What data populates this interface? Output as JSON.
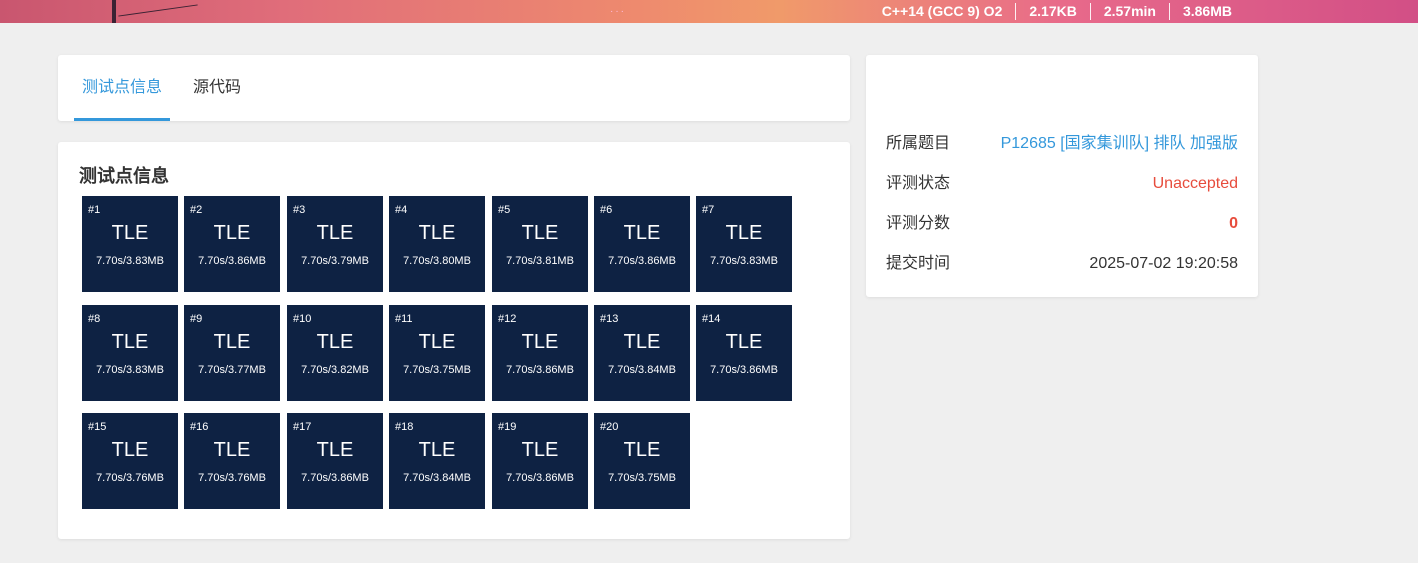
{
  "banner": {
    "stats": [
      "C++14 (GCC 9) O2",
      "2.17KB",
      "2.57min",
      "3.86MB"
    ]
  },
  "tabs": [
    {
      "label": "测试点信息",
      "active": true
    },
    {
      "label": "源代码",
      "active": false
    }
  ],
  "cases": {
    "title": "测试点信息",
    "items": [
      {
        "id": "#1",
        "status": "TLE",
        "info": "7.70s/3.83MB"
      },
      {
        "id": "#2",
        "status": "TLE",
        "info": "7.70s/3.86MB"
      },
      {
        "id": "#3",
        "status": "TLE",
        "info": "7.70s/3.79MB"
      },
      {
        "id": "#4",
        "status": "TLE",
        "info": "7.70s/3.80MB"
      },
      {
        "id": "#5",
        "status": "TLE",
        "info": "7.70s/3.81MB"
      },
      {
        "id": "#6",
        "status": "TLE",
        "info": "7.70s/3.86MB"
      },
      {
        "id": "#7",
        "status": "TLE",
        "info": "7.70s/3.83MB"
      },
      {
        "id": "#8",
        "status": "TLE",
        "info": "7.70s/3.83MB"
      },
      {
        "id": "#9",
        "status": "TLE",
        "info": "7.70s/3.77MB"
      },
      {
        "id": "#10",
        "status": "TLE",
        "info": "7.70s/3.82MB"
      },
      {
        "id": "#11",
        "status": "TLE",
        "info": "7.70s/3.75MB"
      },
      {
        "id": "#12",
        "status": "TLE",
        "info": "7.70s/3.86MB"
      },
      {
        "id": "#13",
        "status": "TLE",
        "info": "7.70s/3.84MB"
      },
      {
        "id": "#14",
        "status": "TLE",
        "info": "7.70s/3.86MB"
      },
      {
        "id": "#15",
        "status": "TLE",
        "info": "7.70s/3.76MB"
      },
      {
        "id": "#16",
        "status": "TLE",
        "info": "7.70s/3.76MB"
      },
      {
        "id": "#17",
        "status": "TLE",
        "info": "7.70s/3.86MB"
      },
      {
        "id": "#18",
        "status": "TLE",
        "info": "7.70s/3.84MB"
      },
      {
        "id": "#19",
        "status": "TLE",
        "info": "7.70s/3.86MB"
      },
      {
        "id": "#20",
        "status": "TLE",
        "info": "7.70s/3.75MB"
      }
    ]
  },
  "info": {
    "problem_label": "所属题目",
    "problem_value": "P12685 [国家集训队] 排队 加强版",
    "status_label": "评测状态",
    "status_value": "Unaccepted",
    "score_label": "评测分数",
    "score_value": "0",
    "time_label": "提交时间",
    "time_value": "2025-07-02 19:20:58"
  },
  "colors": {
    "accent": "#3498db",
    "tile_bg": "#0e2243",
    "error": "#e74c3c",
    "background": "#efefef"
  }
}
